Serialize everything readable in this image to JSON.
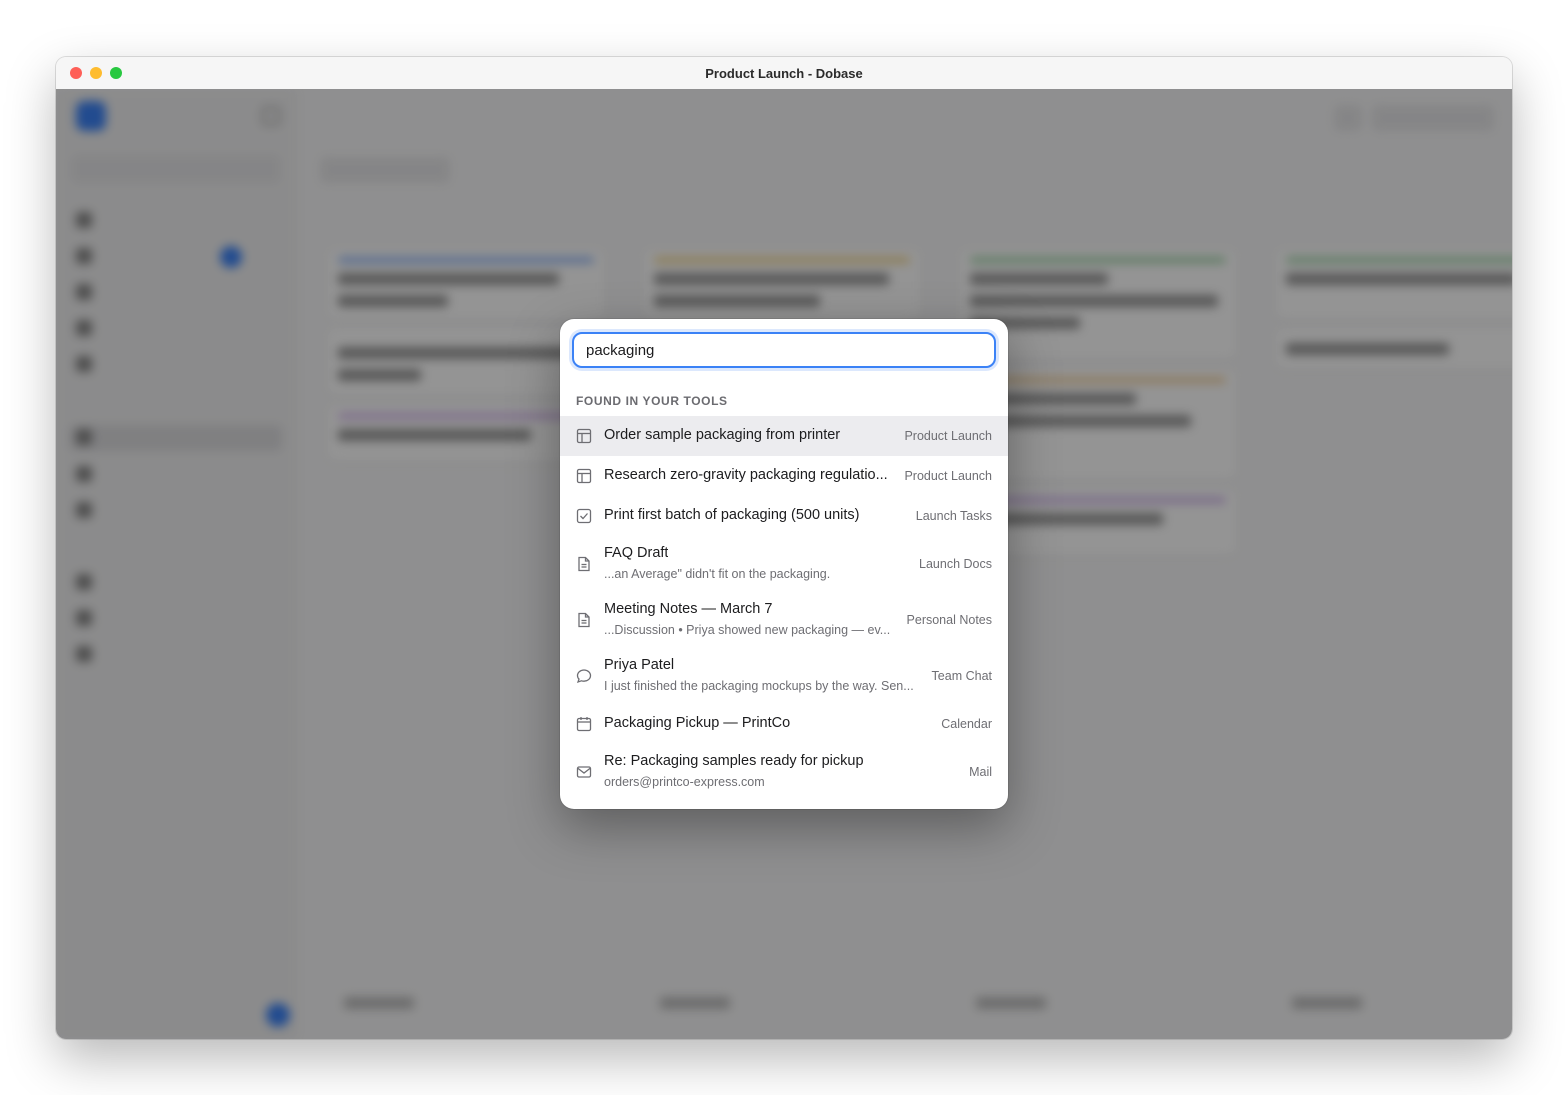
{
  "window": {
    "title": "Product Launch - Dobase"
  },
  "search": {
    "value": "packaging"
  },
  "section": {
    "header": "FOUND IN YOUR TOOLS"
  },
  "results": [
    {
      "icon": "board-icon",
      "title": "Order sample packaging from printer",
      "subtitle": "",
      "source": "Product Launch",
      "selected": true
    },
    {
      "icon": "board-icon",
      "title": "Research zero-gravity packaging regulatio...",
      "subtitle": "",
      "source": "Product Launch",
      "selected": false
    },
    {
      "icon": "checkbox-icon",
      "title": "Print first batch of packaging (500 units)",
      "subtitle": "",
      "source": "Launch Tasks",
      "selected": false
    },
    {
      "icon": "document-icon",
      "title": "FAQ Draft",
      "subtitle": "...an Average\" didn't fit on the packaging.",
      "source": "Launch Docs",
      "selected": false
    },
    {
      "icon": "document-icon",
      "title": "Meeting Notes — March 7",
      "subtitle": "...Discussion • Priya showed new packaging — ev...",
      "source": "Personal Notes",
      "selected": false
    },
    {
      "icon": "chat-icon",
      "title": "Priya Patel",
      "subtitle": "I just finished the packaging mockups by the way. Sen...",
      "source": "Team Chat",
      "selected": false
    },
    {
      "icon": "calendar-icon",
      "title": "Packaging Pickup — PrintCo",
      "subtitle": "",
      "source": "Calendar",
      "selected": false
    },
    {
      "icon": "mail-icon",
      "title": "Re: Packaging samples ready for pickup",
      "subtitle": "orders@printco-express.com",
      "source": "Mail",
      "selected": false
    }
  ],
  "colors": {
    "accent": "#3b82f6",
    "overlay": "rgba(0,0,0,0.42)",
    "selected_row": "#ececef"
  }
}
